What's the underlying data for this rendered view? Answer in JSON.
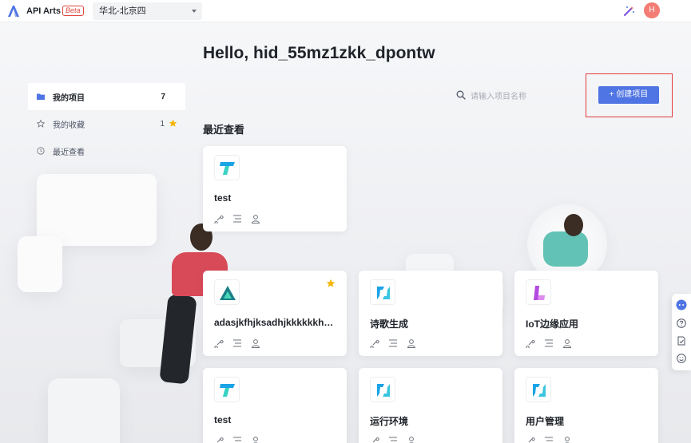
{
  "app": {
    "name": "API Arts",
    "badge": "Beta",
    "region": "华北-北京四",
    "avatar_letter": "H"
  },
  "greeting": "Hello, hid_55mz1zkk_dpontw",
  "sidebar": {
    "items": [
      {
        "label": "我的项目",
        "count": "7",
        "icon": "folder-icon",
        "active": true
      },
      {
        "label": "我的收藏",
        "count": "1",
        "icon": "star-outline-icon",
        "active": false
      },
      {
        "label": "最近查看",
        "count": "",
        "icon": "clock-icon",
        "active": false
      }
    ]
  },
  "search": {
    "placeholder": "请输入项目名称"
  },
  "create_button": {
    "label": "+ 创建项目"
  },
  "recent_title": "最近查看",
  "cards": [
    {
      "name": "test",
      "icon": "t-logo-icon",
      "favorite": false
    },
    {
      "name": "adasjkfhjksadhjkkkkkkhjkkkkk",
      "icon": "triangle-logo-icon",
      "favorite": true
    },
    {
      "name": "诗歌生成",
      "icon": "bracket-logo-icon",
      "favorite": false
    },
    {
      "name": "IoT边缘应用",
      "icon": "l-logo-icon",
      "favorite": false
    },
    {
      "name": "test",
      "icon": "t-logo-icon",
      "favorite": false
    },
    {
      "name": "运行环境",
      "icon": "bracket-logo-icon",
      "favorite": false
    },
    {
      "name": "用户管理",
      "icon": "bracket-logo-icon",
      "favorite": false
    }
  ],
  "colors": {
    "accent": "#4f74e3",
    "favorite_star": "#f5b50a",
    "avatar": "#f37c74",
    "highlight_frame": "#e23b3b"
  }
}
